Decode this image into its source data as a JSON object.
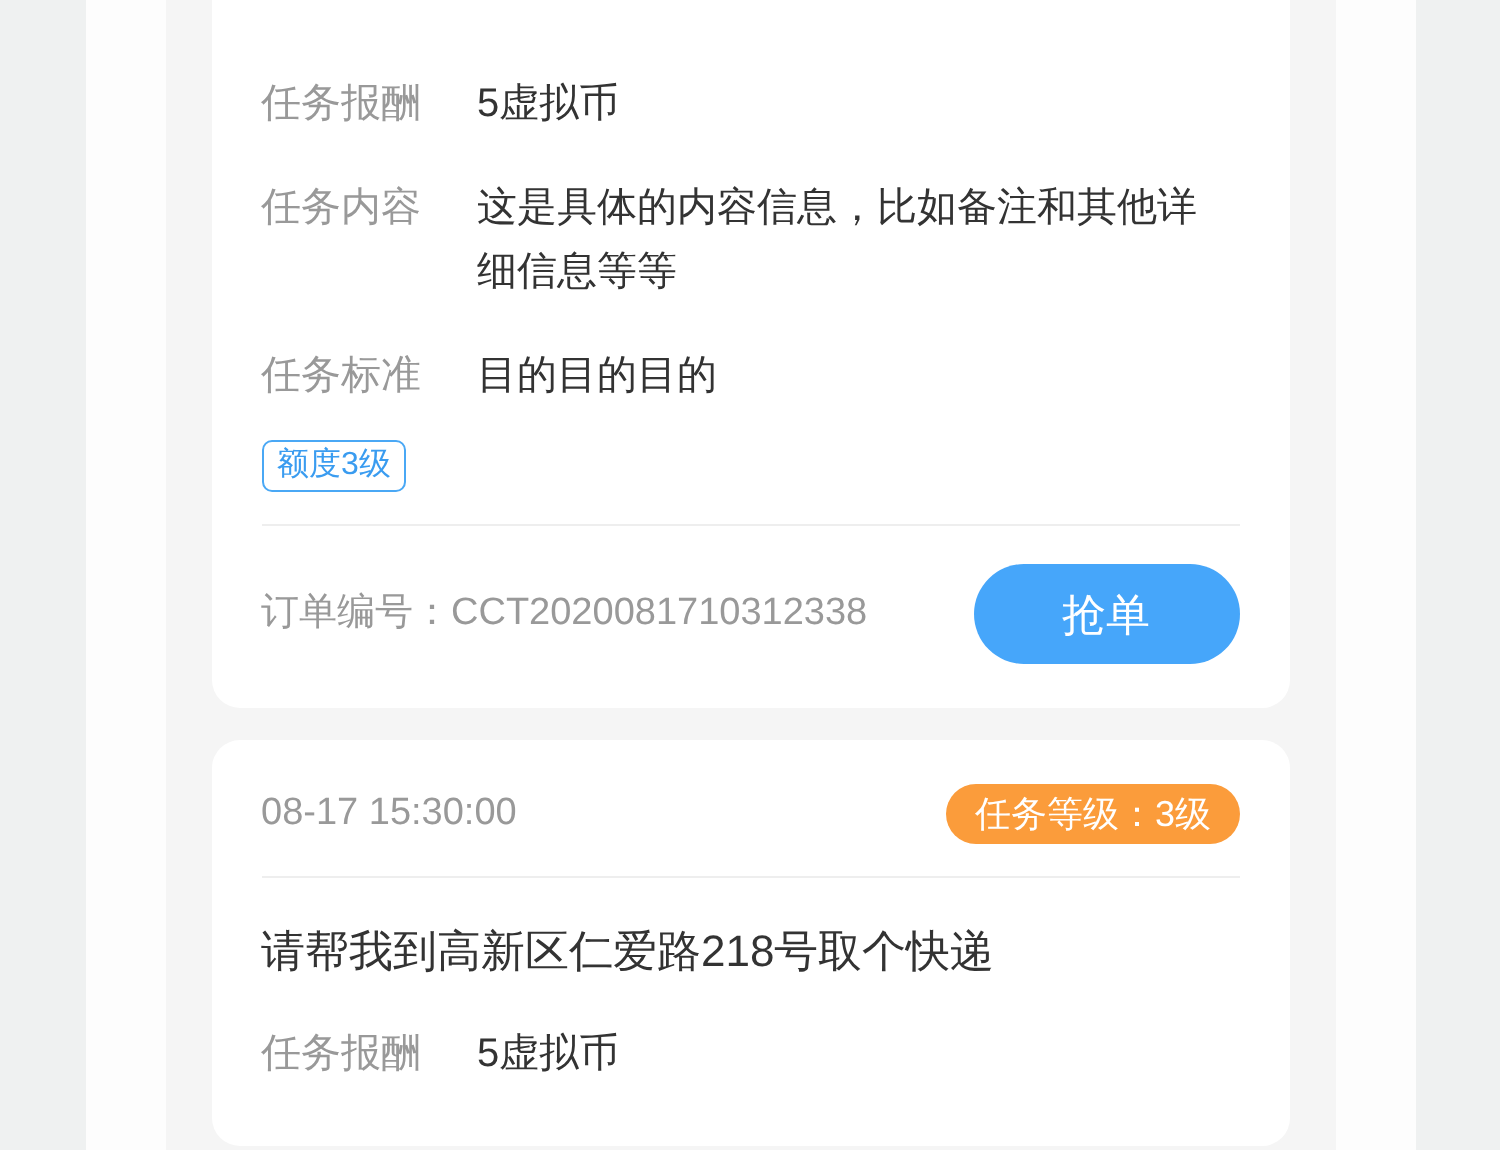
{
  "cards": [
    {
      "fields": [
        {
          "label": "任务报酬",
          "value": "5虚拟币"
        },
        {
          "label": "任务内容",
          "value": "这是具体的内容信息，比如备注和其他详细信息等等"
        },
        {
          "label": "任务标准",
          "value": "目的目的目的"
        }
      ],
      "tags": [
        "额度3级"
      ],
      "order_number": "订单编号：CCT2020081710312338",
      "button": "抢单"
    },
    {
      "time": "08-17 15:30:00",
      "level_badge": "任务等级：3级",
      "title": "请帮我到高新区仁爱路218号取个快递",
      "fields": [
        {
          "label": "任务报酬",
          "value": "5虚拟币"
        }
      ]
    }
  ]
}
